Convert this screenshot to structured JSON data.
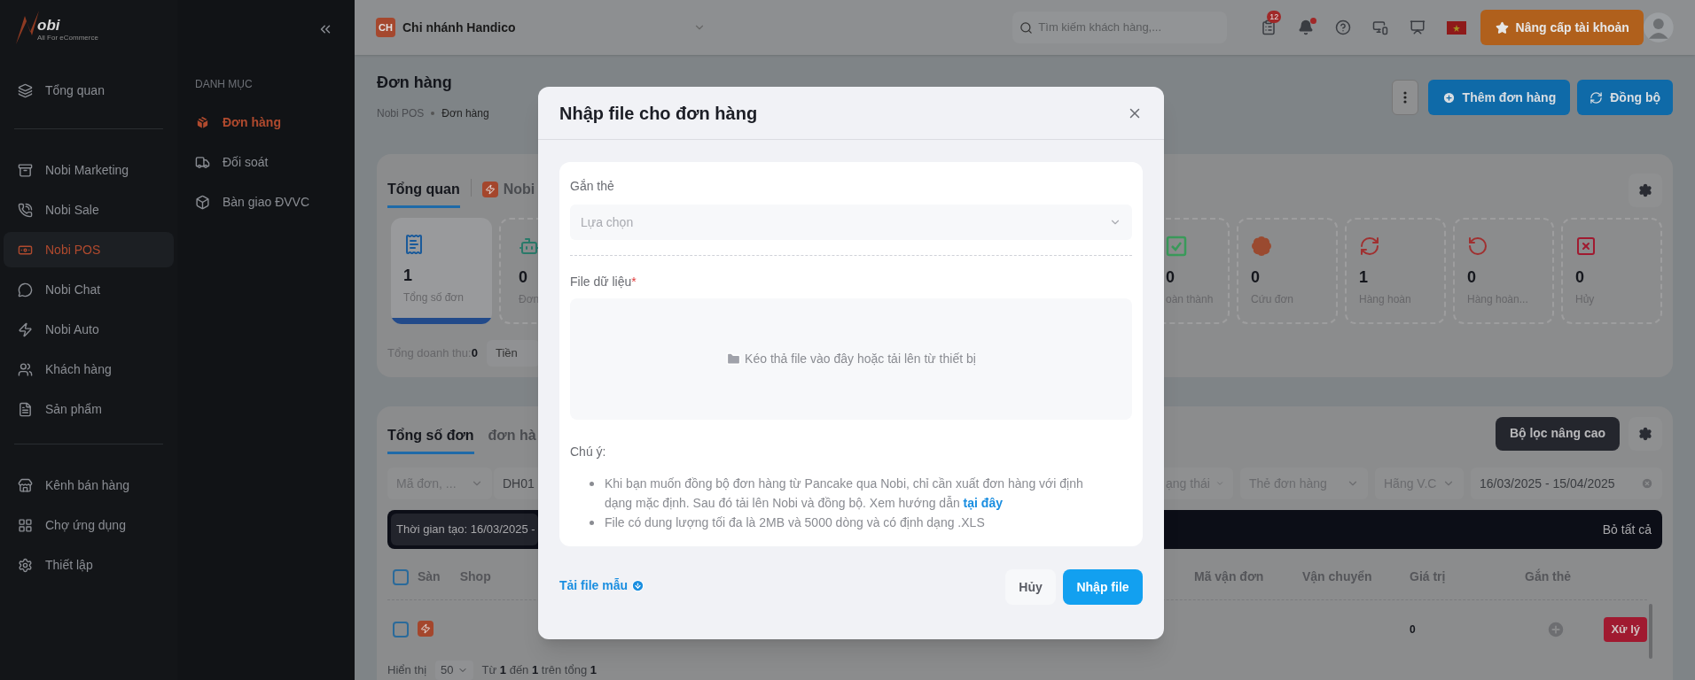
{
  "logo": {
    "wordmark": "obi",
    "tagline": "All For eCommerce"
  },
  "sidebar": {
    "groups": [
      {
        "items": [
          {
            "label": "Tổng quan",
            "selected": false
          }
        ]
      },
      {
        "items": [
          {
            "label": "Nobi Marketing",
            "selected": false
          },
          {
            "label": "Nobi Sale",
            "selected": false
          },
          {
            "label": "Nobi POS",
            "selected": true
          },
          {
            "label": "Nobi Chat",
            "selected": false
          },
          {
            "label": "Nobi Auto",
            "selected": false
          },
          {
            "label": "Khách hàng",
            "selected": false
          },
          {
            "label": "Sản phẩm",
            "selected": false
          }
        ]
      },
      {
        "items": [
          {
            "label": "Kênh bán hàng",
            "selected": false
          },
          {
            "label": "Chợ ứng dụng",
            "selected": false
          },
          {
            "label": "Thiết lập",
            "selected": false
          }
        ]
      }
    ]
  },
  "submenu": {
    "heading": "DANH MỤC",
    "items": [
      {
        "label": "Đơn hàng",
        "selected": true
      },
      {
        "label": "Đối soát",
        "selected": false
      },
      {
        "label": "Bàn giao ĐVVC",
        "selected": false
      }
    ]
  },
  "topbar": {
    "branch": {
      "badge": "CH",
      "name": "Chi nhánh Handico"
    },
    "search": {
      "placeholder": "Tìm kiếm khách hàng,..."
    },
    "task_count": "12",
    "bell_unread": true,
    "upgrade_button": "Nâng cấp tài khoản"
  },
  "page": {
    "title": "Đơn hàng",
    "breadcrumb": [
      "Nobi POS",
      "Đơn hàng"
    ],
    "actions": [
      "Thêm đơn hàng",
      "Đồng bộ"
    ]
  },
  "overview": {
    "tabs": [
      {
        "label": "Tổng quan",
        "selected": true
      },
      {
        "label": "Nobi",
        "selected": false
      }
    ],
    "stats_left": [
      {
        "value": "1",
        "label": "Tổng số đơn",
        "selected": true
      },
      {
        "value": "0",
        "label": "Đơn",
        "selected": false
      }
    ],
    "stats_right": [
      {
        "value": "0",
        "label": "oàn thành",
        "selected": false
      },
      {
        "value": "0",
        "label": "Cứu đơn",
        "selected": false
      },
      {
        "value": "1",
        "label": "Hàng hoàn",
        "selected": false
      },
      {
        "value": "0",
        "label": "Hàng hoàn...",
        "selected": false
      },
      {
        "value": "0",
        "label": "Hủy",
        "selected": false
      }
    ],
    "revenue": "Tổng doanh thu:**0**",
    "chip": "Tiền"
  },
  "orders": {
    "tabs": [
      {
        "label": "Tổng số đơn",
        "selected": true
      },
      {
        "label": "đơn hà",
        "selected": false
      }
    ],
    "advanced_filter_button": "Bộ lọc nâng cao",
    "filters_left": [
      {
        "kind": "select",
        "text": "Mã đơn, ..."
      },
      {
        "kind": "input",
        "text": "DH01"
      }
    ],
    "filters_right": [
      {
        "kind": "select",
        "text": "ạng thái"
      },
      {
        "kind": "select",
        "text": "Thẻ đơn hàng"
      },
      {
        "kind": "select",
        "text": "Hãng V.C"
      },
      {
        "kind": "date",
        "text": "16/03/2025 - 15/04/2025"
      }
    ],
    "select_all_checked": false,
    "active_filter": "Thời gian tạo: 16/03/2025 -",
    "clear_all": "Bỏ tất cả",
    "columns_left": [
      "Sàn",
      "Shop"
    ],
    "columns_right": [
      "Mã vận đơn",
      "Vận chuyển",
      "Giá trị",
      "Gắn thẻ"
    ],
    "rows": [
      {
        "checked": false,
        "value": "0",
        "action": "Xử lý"
      }
    ],
    "pagination": {
      "label": "Hiển thị",
      "page_size": "50",
      "range": "Từ **1** đến **1** trên tổng **1**"
    }
  },
  "modal": {
    "title": "Nhập file cho đơn hàng",
    "tag_field": {
      "label": "Gắn thẻ",
      "placeholder": "Lựa chọn"
    },
    "file_field": {
      "label": "File dữ liệu",
      "required_mark": "*",
      "dropzone": "Kéo thả file vào đây hoặc tải lên từ thiết bị"
    },
    "notes": {
      "heading": "Chú ý:",
      "items": [
        {
          "text": "Khi bạn muốn đồng bộ đơn hàng từ Pancake qua Nobi, chỉ cần xuất đơn hàng với định dạng mặc định. Sau đó tải lên Nobi và đồng bộ. Xem hướng dẫn",
          "link": "tại đây"
        },
        {
          "text": "File có dung lượng tối đa là 2MB và 5000 dòng và có định dạng .XLS"
        }
      ]
    },
    "template_link": "Tải file mẫu",
    "buttons": [
      "Hủy",
      "Nhập file"
    ]
  }
}
